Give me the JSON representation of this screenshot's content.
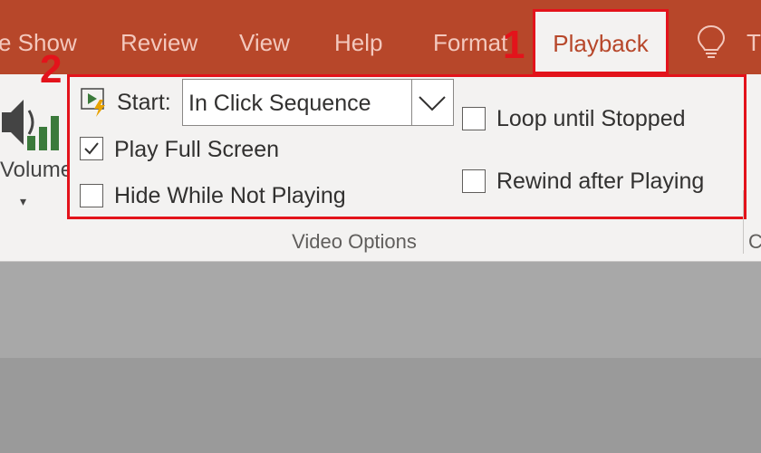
{
  "tabs": {
    "slide_show": "e Show",
    "review": "Review",
    "view": "View",
    "help": "Help",
    "format": "Format",
    "playback": "Playback",
    "tell_me_partial": "T"
  },
  "markers": {
    "one": "1",
    "two": "2"
  },
  "volume": {
    "label": "Volume",
    "caret": "▾"
  },
  "video_options": {
    "start_label": "Start:",
    "start_value": "In Click Sequence",
    "play_full_screen": {
      "label": "Play Full Screen",
      "checked": true
    },
    "hide_while_not_playing": {
      "label": "Hide While Not Playing",
      "checked": false
    },
    "loop_until_stopped": {
      "label": "Loop until Stopped",
      "checked": false
    },
    "rewind_after_playing": {
      "label": "Rewind after Playing",
      "checked": false
    },
    "group_label": "Video Options",
    "next_group_partial": "C"
  },
  "icons": {
    "lightbulb": "lightbulb-icon",
    "speaker": "speaker-icon",
    "start": "play-lightning-icon",
    "dropdown": "chevron-down-icon",
    "check": "checkmark-icon"
  },
  "colors": {
    "ribbon_tabbar": "#b7472a",
    "highlight": "#e3131b",
    "ribbon_body": "#f3f2f1"
  }
}
